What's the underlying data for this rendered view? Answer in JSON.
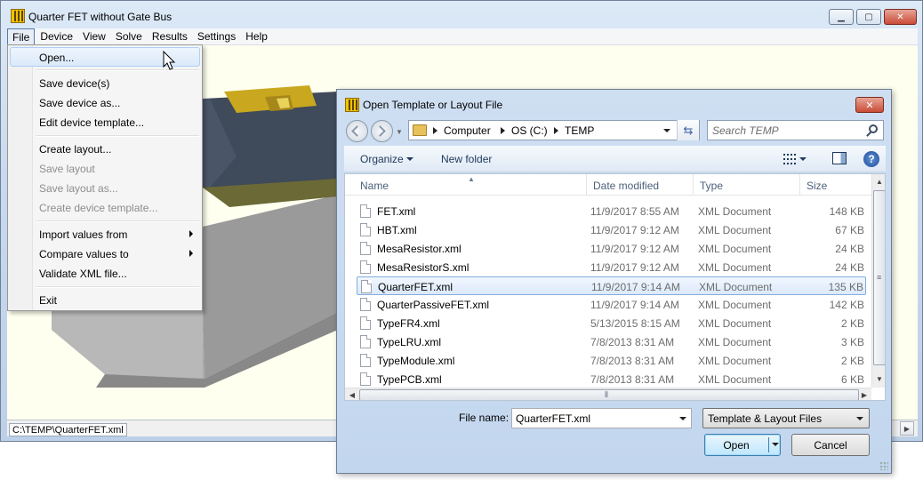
{
  "main_window": {
    "title": "Quarter FET without Gate Bus",
    "caption_buttons": {
      "minimize": "▁",
      "maximize": "▢",
      "close": "✕"
    }
  },
  "menubar": [
    "File",
    "Device",
    "View",
    "Solve",
    "Results",
    "Settings",
    "Help"
  ],
  "file_menu": {
    "items": [
      {
        "label": "Open...",
        "state": "hover"
      },
      {
        "label": "Save device(s)",
        "state": "enabled"
      },
      {
        "label": "Save device as...",
        "state": "enabled"
      },
      {
        "label": "Edit device template...",
        "state": "enabled"
      },
      {
        "label": "Create layout...",
        "state": "enabled"
      },
      {
        "label": "Save layout",
        "state": "disabled"
      },
      {
        "label": "Save layout as...",
        "state": "disabled"
      },
      {
        "label": "Create device template...",
        "state": "disabled"
      },
      {
        "label": "Import values from",
        "state": "submenu"
      },
      {
        "label": "Compare values to",
        "state": "submenu"
      },
      {
        "label": "Validate XML file...",
        "state": "enabled"
      },
      {
        "label": "Exit",
        "state": "enabled"
      }
    ]
  },
  "statusbar": {
    "path": "C:\\TEMP\\QuarterFET.xml"
  },
  "dialog": {
    "title": "Open Template or Layout File",
    "close": "✕",
    "breadcrumb": [
      "Computer",
      "OS (C:)",
      "TEMP"
    ],
    "search_placeholder": "Search TEMP",
    "toolbar": {
      "organize": "Organize",
      "new_folder": "New folder",
      "help": "?"
    },
    "columns": [
      "Name",
      "Date modified",
      "Type",
      "Size"
    ],
    "files": [
      {
        "name": "FET.xml",
        "date": "11/9/2017 8:55 AM",
        "type": "XML Document",
        "size": "148 KB"
      },
      {
        "name": "HBT.xml",
        "date": "11/9/2017 9:12 AM",
        "type": "XML Document",
        "size": "67 KB"
      },
      {
        "name": "MesaResistor.xml",
        "date": "11/9/2017 9:12 AM",
        "type": "XML Document",
        "size": "24 KB"
      },
      {
        "name": "MesaResistorS.xml",
        "date": "11/9/2017 9:12 AM",
        "type": "XML Document",
        "size": "24 KB"
      },
      {
        "name": "QuarterFET.xml",
        "date": "11/9/2017 9:14 AM",
        "type": "XML Document",
        "size": "135 KB",
        "selected": true
      },
      {
        "name": "QuarterPassiveFET.xml",
        "date": "11/9/2017 9:14 AM",
        "type": "XML Document",
        "size": "142 KB"
      },
      {
        "name": "TypeFR4.xml",
        "date": "5/13/2015 8:15 AM",
        "type": "XML Document",
        "size": "2 KB"
      },
      {
        "name": "TypeLRU.xml",
        "date": "7/8/2013 8:31 AM",
        "type": "XML Document",
        "size": "3 KB"
      },
      {
        "name": "TypeModule.xml",
        "date": "7/8/2013 8:31 AM",
        "type": "XML Document",
        "size": "2 KB"
      },
      {
        "name": "TypePCB.xml",
        "date": "7/8/2013 8:31 AM",
        "type": "XML Document",
        "size": "6 KB"
      }
    ],
    "file_name_label": "File name:",
    "file_name_value": "QuarterFET.xml",
    "filter": "Template & Layout Files",
    "open_label": "Open",
    "cancel_label": "Cancel"
  },
  "colors": {
    "accent": "#3c7fb1",
    "canvas": "#fffff0",
    "selection": "#dbe9fb"
  }
}
